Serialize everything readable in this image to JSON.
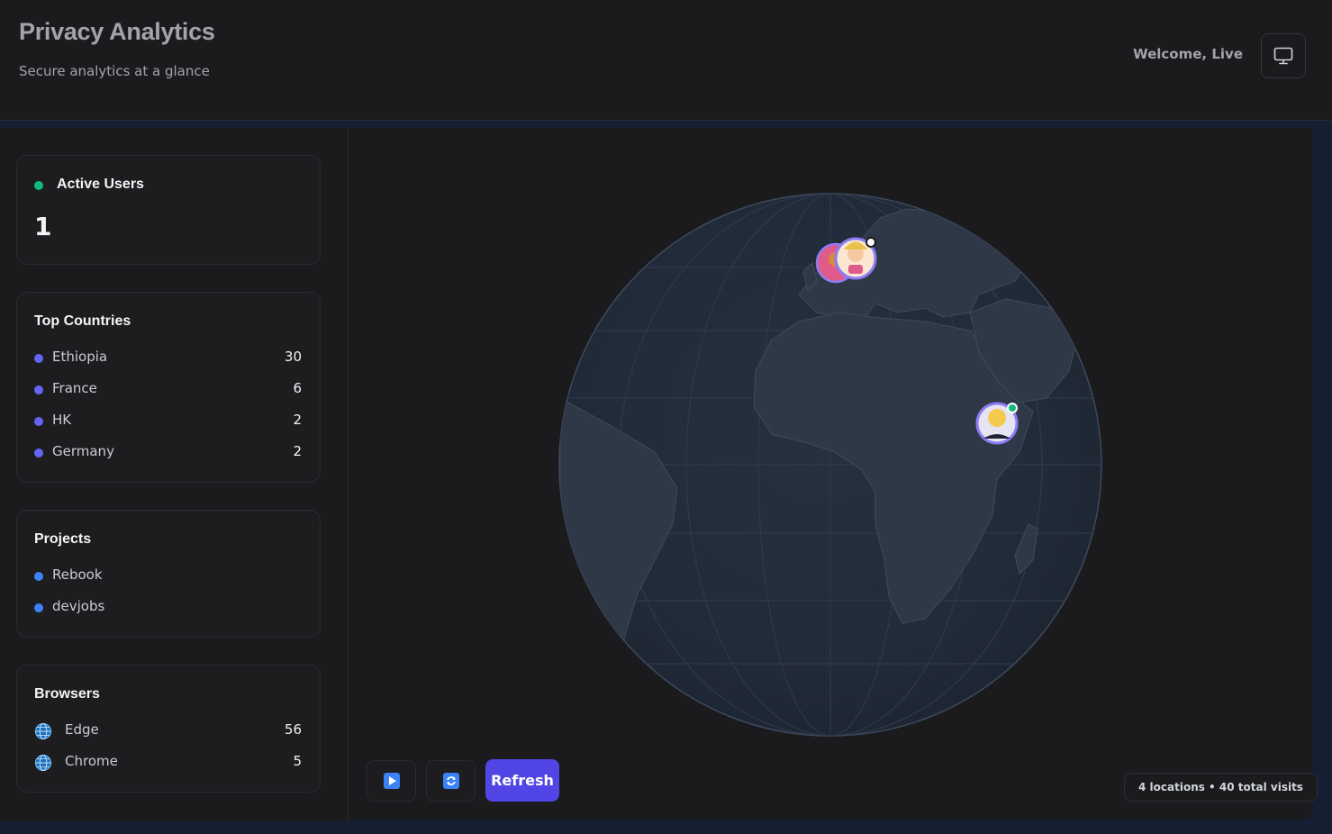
{
  "header": {
    "title": "Privacy Analytics",
    "subtitle": "Secure analytics at a glance",
    "welcome": "Welcome, Live",
    "monitor_icon": "monitor-icon"
  },
  "active_users": {
    "title": "Active Users",
    "value": "1",
    "status_color": "#10b981"
  },
  "top_countries": {
    "title": "Top Countries",
    "items": [
      {
        "label": "Ethiopia",
        "value": "30"
      },
      {
        "label": "France",
        "value": "6"
      },
      {
        "label": "HK",
        "value": "2"
      },
      {
        "label": "Germany",
        "value": "2"
      }
    ]
  },
  "projects": {
    "title": "Projects",
    "items": [
      {
        "label": "Rebook"
      },
      {
        "label": "devjobs"
      }
    ]
  },
  "browsers": {
    "title": "Browsers",
    "icon": "globe-icon",
    "items": [
      {
        "label": "Edge",
        "value": "56"
      },
      {
        "label": "Chrome",
        "value": "5"
      }
    ]
  },
  "controls": {
    "play_icon": "play-icon",
    "rotate_icon": "rotate-icon",
    "refresh_label": "Refresh"
  },
  "stats": {
    "summary": "4 locations • 40 total visits"
  },
  "colors": {
    "accent": "#4f46e5",
    "country_dot": "#6366f1",
    "project_dot": "#3b82f6",
    "online": "#10b981",
    "marker_ring": "#8b7cf6"
  }
}
